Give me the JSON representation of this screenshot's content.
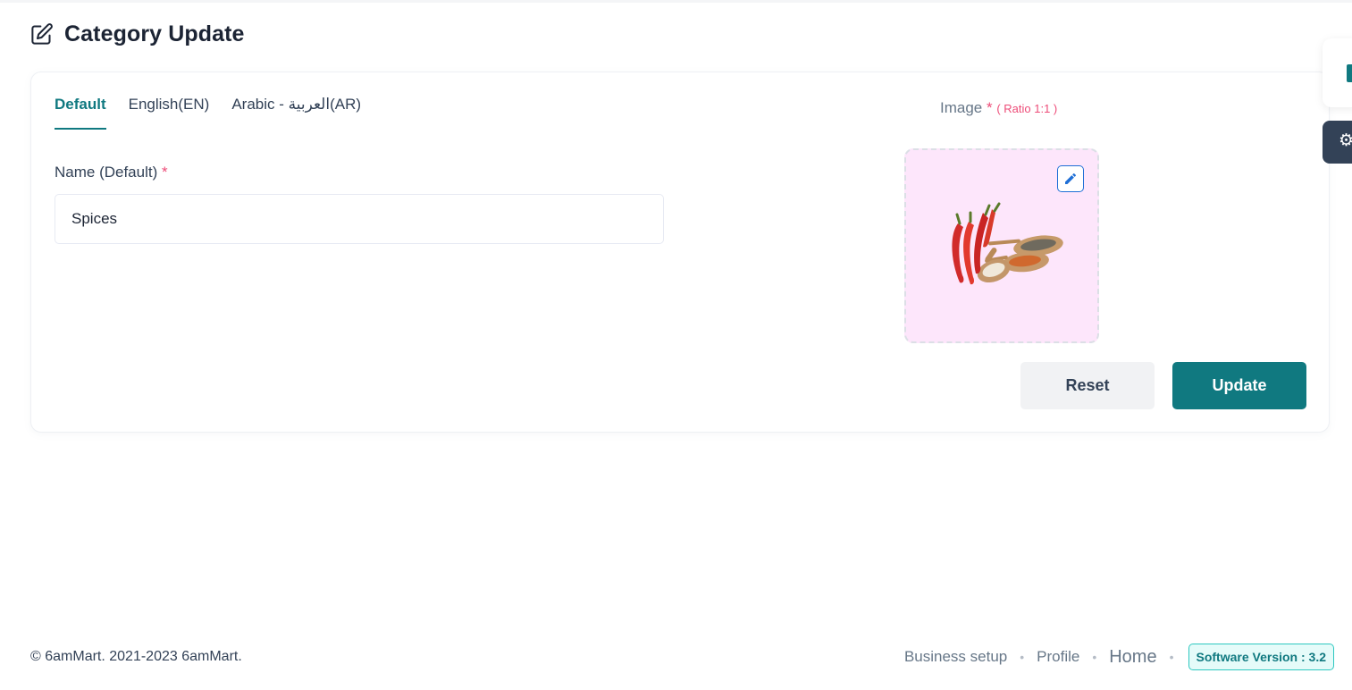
{
  "page": {
    "title": "Category Update"
  },
  "tabs": [
    {
      "label": "Default",
      "active": true
    },
    {
      "label": "English(EN)",
      "active": false
    },
    {
      "label": "Arabic - العربية(AR)",
      "active": false
    }
  ],
  "form": {
    "name_label": "Name (Default)",
    "required_mark": "*",
    "name_value": "Spices"
  },
  "image": {
    "label": "Image",
    "required_mark": "*",
    "ratio_hint": "( Ratio 1:1 )",
    "icon": "edit-pencil-icon"
  },
  "buttons": {
    "reset": "Reset",
    "update": "Update"
  },
  "footer": {
    "copyright": "© 6amMart. 2021-2023 6amMart.",
    "links": [
      "Business setup",
      "Profile",
      "Home"
    ],
    "separator": "•",
    "version": "Software Version : 3.2"
  },
  "colors": {
    "accent": "#107980",
    "required": "#ed4c78",
    "text": "#334257",
    "image_bg": "#fde6fb",
    "side_panel_dark": "#334257"
  },
  "icons": {
    "page_header": "edit-square-icon",
    "side_panel_1": "side-tab-icon",
    "side_panel_2": "gear-icon"
  }
}
